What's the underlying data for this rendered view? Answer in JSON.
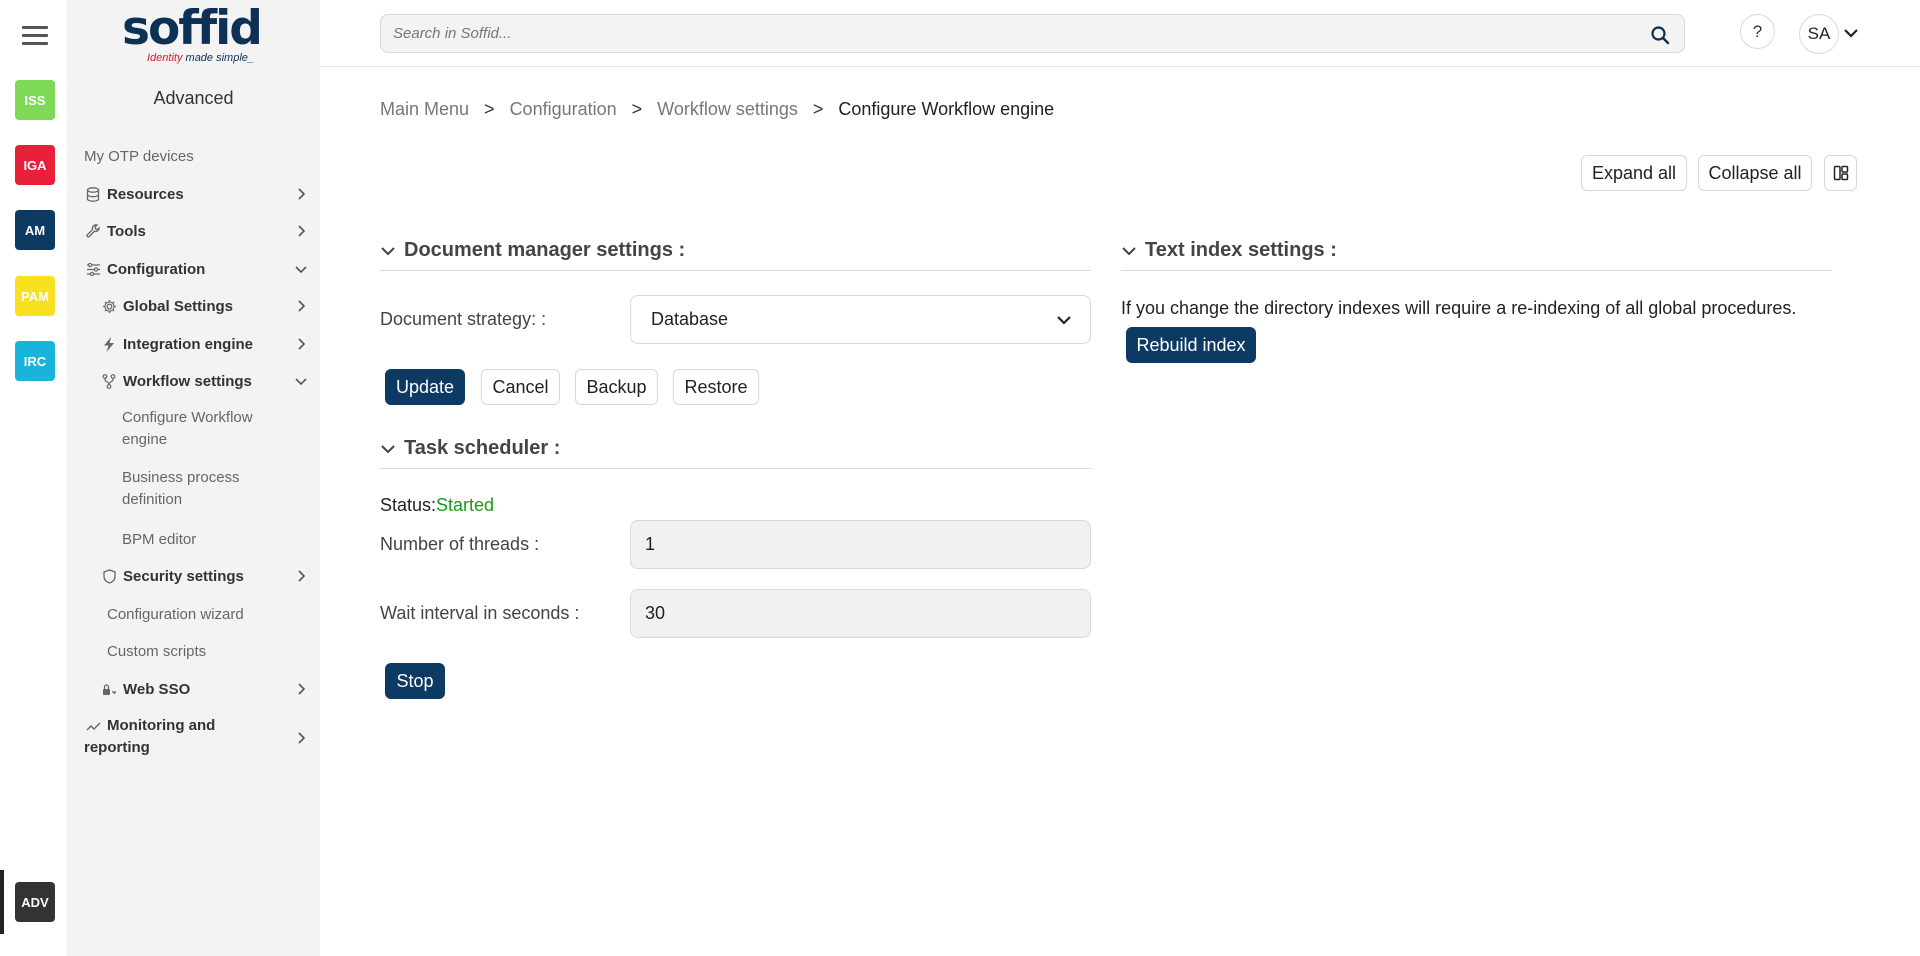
{
  "rail": {
    "apps": [
      {
        "label": "ISS",
        "color": "#7ed957"
      },
      {
        "label": "IGA",
        "color": "#e8203a"
      },
      {
        "label": "AM",
        "color": "#0d3a62"
      },
      {
        "label": "PAM",
        "color": "#f7e020"
      },
      {
        "label": "IRC",
        "color": "#1ab3d9"
      }
    ],
    "active_app": {
      "label": "ADV",
      "color": "#333333"
    }
  },
  "logo": {
    "word": "soffid",
    "tagline_1": "Identity",
    "tagline_2": "made simple_"
  },
  "sidebar": {
    "section_title": "Advanced",
    "items": {
      "otp": "My OTP devices",
      "resources": "Resources",
      "tools": "Tools",
      "configuration": "Configuration",
      "global_settings": "Global Settings",
      "integration_engine": "Integration engine",
      "workflow_settings": "Workflow settings",
      "configure_workflow": "Configure Workflow engine",
      "business_process": "Business process definition",
      "bpm_editor": "BPM editor",
      "security_settings": "Security settings",
      "config_wizard": "Configuration wizard",
      "custom_scripts": "Custom scripts",
      "web_sso": "Web SSO",
      "monitoring": "Monitoring and reporting"
    }
  },
  "search": {
    "placeholder": "Search in Soffid..."
  },
  "topbar": {
    "help": "?",
    "user_initials": "SA"
  },
  "breadcrumb": {
    "items": [
      "Main Menu",
      "Configuration",
      "Workflow settings"
    ],
    "separator": ">",
    "current": "Configure Workflow engine"
  },
  "toolbar": {
    "expand_all": "Expand all",
    "collapse_all": "Collapse all"
  },
  "document_manager": {
    "title": "Document manager settings :",
    "strategy_label": "Document strategy: :",
    "strategy_value": "Database",
    "buttons": {
      "update": "Update",
      "cancel": "Cancel",
      "backup": "Backup",
      "restore": "Restore"
    }
  },
  "task_scheduler": {
    "title": "Task scheduler :",
    "status_label": "Status:",
    "status_value": "Started",
    "threads_label": "Number of threads :",
    "threads_value": "1",
    "interval_label": "Wait interval in seconds :",
    "interval_value": "30",
    "stop": "Stop"
  },
  "text_index": {
    "title": "Text index settings :",
    "info": "If you change the directory indexes will require a re-indexing of all global procedures.",
    "rebuild": "Rebuild index"
  }
}
